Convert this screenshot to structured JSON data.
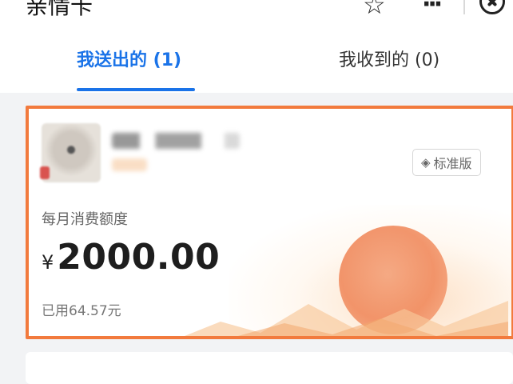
{
  "header": {
    "title": "亲情卡",
    "icons": [
      "star-icon",
      "more-icon",
      "close-icon"
    ]
  },
  "tabs": [
    {
      "label": "我送出的 (1)",
      "active": true
    },
    {
      "label": "我收到的 (0)",
      "active": false
    }
  ],
  "card": {
    "edition_badge": "标准版",
    "quota_label": "每月消费额度",
    "currency": "¥",
    "amount": "2000.00",
    "used": "已用64.57元"
  },
  "colors": {
    "accent": "#1a73e8",
    "highlight_border": "#f27a3d"
  }
}
